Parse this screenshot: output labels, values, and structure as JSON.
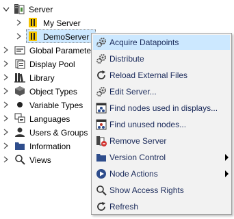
{
  "tree": {
    "root": {
      "label": "Server",
      "icon": "server-group-icon"
    },
    "items": [
      {
        "label": "My Server",
        "icon": "server-icon"
      },
      {
        "label": "DemoServer",
        "icon": "server-icon"
      },
      {
        "label": "Global Parameter",
        "icon": "global-parameter-icon"
      },
      {
        "label": "Display Pool",
        "icon": "display-pool-icon"
      },
      {
        "label": "Library",
        "icon": "library-icon"
      },
      {
        "label": "Object Types",
        "icon": "object-types-icon"
      },
      {
        "label": "Variable Types",
        "icon": "variable-types-icon"
      },
      {
        "label": "Languages",
        "icon": "languages-icon"
      },
      {
        "label": "Users & Groups",
        "icon": "users-icon"
      },
      {
        "label": "Information",
        "icon": "folder-icon"
      },
      {
        "label": "Views",
        "icon": "search-icon"
      }
    ]
  },
  "context_menu": {
    "items": [
      {
        "label": "Acquire Datapoints",
        "icon": "gears-icon",
        "highlighted": true
      },
      {
        "label": "Distribute",
        "icon": "gears-icon"
      },
      {
        "label": "Reload External Files",
        "icon": "reload-icon"
      },
      {
        "label": "Edit Server...",
        "icon": "gears-icon"
      },
      {
        "label": "Find nodes used in displays...",
        "icon": "find-nodes-icon"
      },
      {
        "label": "Find unused nodes...",
        "icon": "find-unused-icon"
      },
      {
        "label": "Remove Server",
        "icon": "remove-server-icon"
      },
      {
        "label": "Version Control",
        "icon": "version-control-icon",
        "submenu": true
      },
      {
        "label": "Node Actions",
        "icon": "play-icon",
        "submenu": true
      },
      {
        "label": "Show Access Rights",
        "icon": "magnifier-icon"
      },
      {
        "label": "Refresh",
        "icon": "refresh-icon"
      }
    ]
  },
  "colors": {
    "selection": "#cce8ff",
    "menu_bg": "#f2f2f2",
    "menu_text": "#1a2a5a",
    "accent_yellow": "#f5c400"
  }
}
